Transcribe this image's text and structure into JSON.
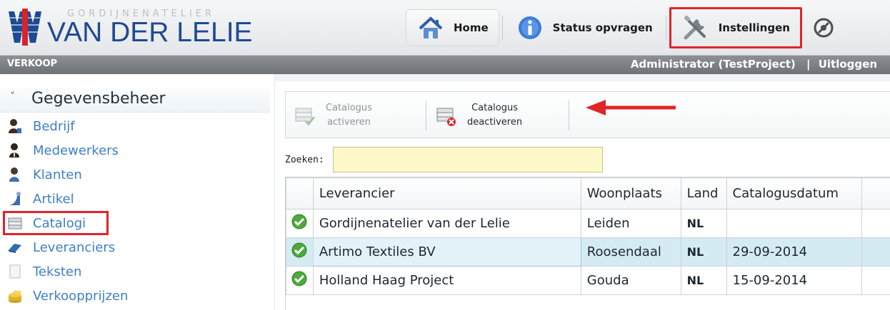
{
  "brand": {
    "subtitle": "GORDIJNENATELIER",
    "name": "VAN DER LELIE"
  },
  "topnav": {
    "home": "Home",
    "status": "Status opvragen",
    "settings": "Instellingen"
  },
  "statusbar": {
    "module": "VERKOOP",
    "user": "Administrator (TestProject)",
    "logout": "Uitloggen"
  },
  "sidebar": {
    "section": "Gegevensbeheer",
    "items": [
      {
        "label": "Bedrijf",
        "icon": "company-icon"
      },
      {
        "label": "Medewerkers",
        "icon": "employee-icon"
      },
      {
        "label": "Klanten",
        "icon": "customer-icon"
      },
      {
        "label": "Artikel",
        "icon": "article-icon"
      },
      {
        "label": "Catalogi",
        "icon": "catalog-icon",
        "active": true
      },
      {
        "label": "Leveranciers",
        "icon": "supplier-icon"
      },
      {
        "label": "Teksten",
        "icon": "text-icon"
      },
      {
        "label": "Verkoopprijzen",
        "icon": "price-icon"
      }
    ]
  },
  "toolbar": {
    "activate_line1": "Catalogus",
    "activate_line2": "activeren",
    "deactivate_line1": "Catalogus",
    "deactivate_line2": "deactiveren"
  },
  "search": {
    "label": "Zoeken:",
    "value": ""
  },
  "grid": {
    "columns": [
      "Leverancier",
      "Woonplaats",
      "Land",
      "Catalogusdatum"
    ],
    "rows": [
      {
        "leverancier": "Gordijnenatelier van der Lelie",
        "woonplaats": "Leiden",
        "land": "NL",
        "datum": ""
      },
      {
        "leverancier": "Artimo Textiles BV",
        "woonplaats": "Roosendaal",
        "land": "NL",
        "datum": "29-09-2014",
        "selected": true
      },
      {
        "leverancier": "Holland Haag Project",
        "woonplaats": "Gouda",
        "land": "NL",
        "datum": "15-09-2014"
      }
    ]
  },
  "colors": {
    "brand_blue": "#1e4a93",
    "highlight_red": "#e0242a",
    "link_blue": "#3f7fc5",
    "statusbar": "#7a7e82"
  }
}
